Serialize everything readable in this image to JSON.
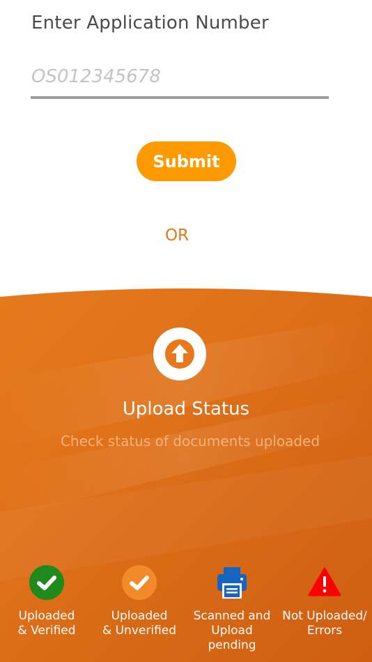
{
  "form": {
    "label": "Enter Application Number",
    "placeholder": "OS012345678",
    "submit_label": "Submit",
    "or_text": "OR"
  },
  "upload": {
    "title": "Upload Status",
    "subtitle": "Check status of documents uploaded"
  },
  "legend": [
    {
      "icon": "green-check-circle-icon",
      "label": "Uploaded\n& Verified",
      "color": "#1e8a1e"
    },
    {
      "icon": "orange-check-circle-icon",
      "label": "Uploaded\n& Unverified",
      "color": "#f28a2a"
    },
    {
      "icon": "blue-printer-icon",
      "label": "Scanned and\nUpload\npending",
      "color": "#1565c0"
    },
    {
      "icon": "red-warning-icon",
      "label": "Not Uploaded/\nErrors",
      "color": "#ff0000"
    }
  ],
  "colors": {
    "accent": "#fd9a00",
    "panel_orange": "#e4781a",
    "panel_dark": "#c85a10",
    "or_text": "#e67817"
  }
}
